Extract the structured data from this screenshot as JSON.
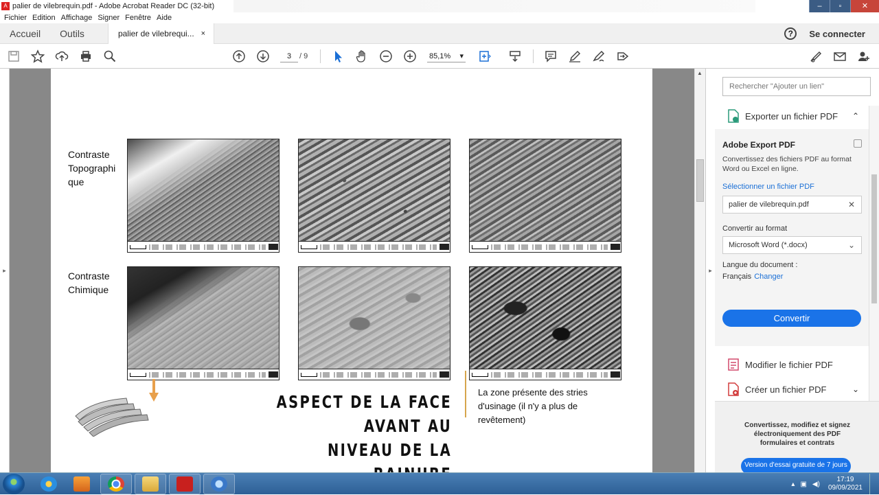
{
  "window": {
    "title": "palier de vilebrequin.pdf - Adobe Acrobat Reader DC (32-bit)",
    "icon": "pdf-icon",
    "controls": [
      "minimize",
      "maximize",
      "close"
    ]
  },
  "menu": [
    "Fichier",
    "Edition",
    "Affichage",
    "Signer",
    "Fenêtre",
    "Aide"
  ],
  "tabs": {
    "home": "Accueil",
    "tools": "Outils",
    "document": "palier de vilebrequi...",
    "document_close": "×",
    "help": "?",
    "connect": "Se connecter"
  },
  "toolbar": {
    "current_page": "3",
    "total_pages": "/ 9",
    "zoom": "85,1%",
    "zoom_arrow": "▾",
    "left_icons": [
      "save-icon",
      "star-icon",
      "upload-icon",
      "print-icon",
      "search-zoom-icon"
    ],
    "nav_icons": [
      "page-up-icon",
      "page-down-icon"
    ],
    "tool_icons": [
      "select-cursor-icon",
      "hand-icon",
      "zoom-out-icon",
      "zoom-in-icon"
    ],
    "right_icons": [
      "comment-icon",
      "highlight-pen-icon",
      "sign-icon",
      "share-icon"
    ]
  },
  "document": {
    "row_labels": [
      "Contraste\nTopographi\nque",
      "Contraste\nChimique"
    ],
    "heading_line1": "ASPECT DE LA FACE AVANT AU",
    "heading_line2": "NIVEAU DE LA RAINURE",
    "conclusion": "La zone présente des stries d'usinage (il n'y a plus de revêtement)",
    "accent_color": "#d6a54c",
    "arrow_color": "#e8a04c"
  },
  "panel": {
    "search_placeholder": "Rechercher \"Ajouter un lien\"",
    "export_title": "Exporter un fichier PDF",
    "export_chevron": "⌃",
    "adobe_export": "Adobe Export PDF",
    "description": "Convertissez des fichiers PDF au format Word ou Excel en ligne.",
    "select_link": "Sélectionner un fichier PDF",
    "selected_file": "palier de vilebrequin.pdf",
    "clear": "✕",
    "convert_label": "Convertir au format",
    "format": "Microsoft Word (*.docx)",
    "format_arrow": "⌄",
    "language_label": "Langue du document :",
    "language": "Français",
    "change": "Changer",
    "convert_button": "Convertir",
    "edit_pdf": "Modifier le fichier PDF",
    "create_pdf": "Créer un fichier PDF",
    "create_chevron": "⌄",
    "promo": "Convertissez, modifiez et signez électroniquement des PDF formulaires et contrats",
    "trial": "Version d'essai gratuite de 7 jours",
    "accent": "#1a73e8"
  },
  "taskbar": {
    "time": "17:19",
    "date": "09/09/2021",
    "apps": [
      "ie-icon",
      "media-icon",
      "chrome-icon",
      "explorer-icon",
      "acrobat-icon",
      "app-icon"
    ]
  }
}
